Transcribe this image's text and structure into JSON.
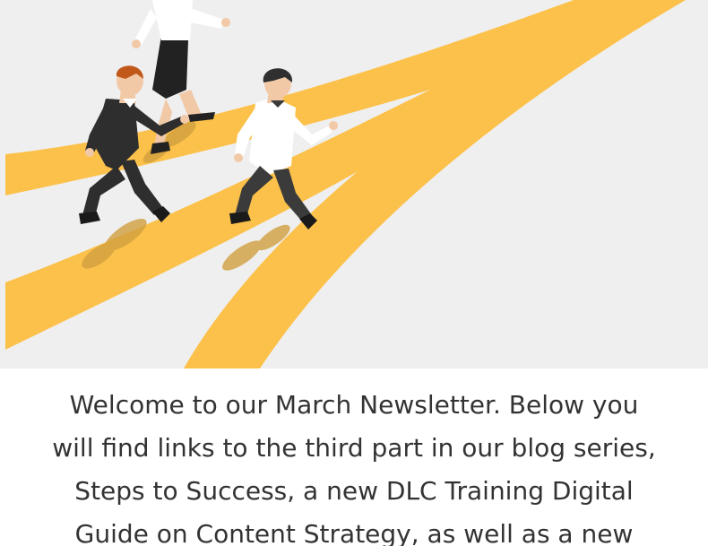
{
  "colors": {
    "background": "#efefef",
    "road": "#fcc14a",
    "text": "#333333"
  },
  "hero": {
    "illustration": "people-running-on-paths-illustration"
  },
  "intro": {
    "lines": [
      "Welcome to our March Newsletter. Below you",
      "will find links to the third part in our blog series,",
      "Steps to Success, a new DLC Training Digital",
      "Guide on Content Strategy, as well as a new"
    ]
  }
}
